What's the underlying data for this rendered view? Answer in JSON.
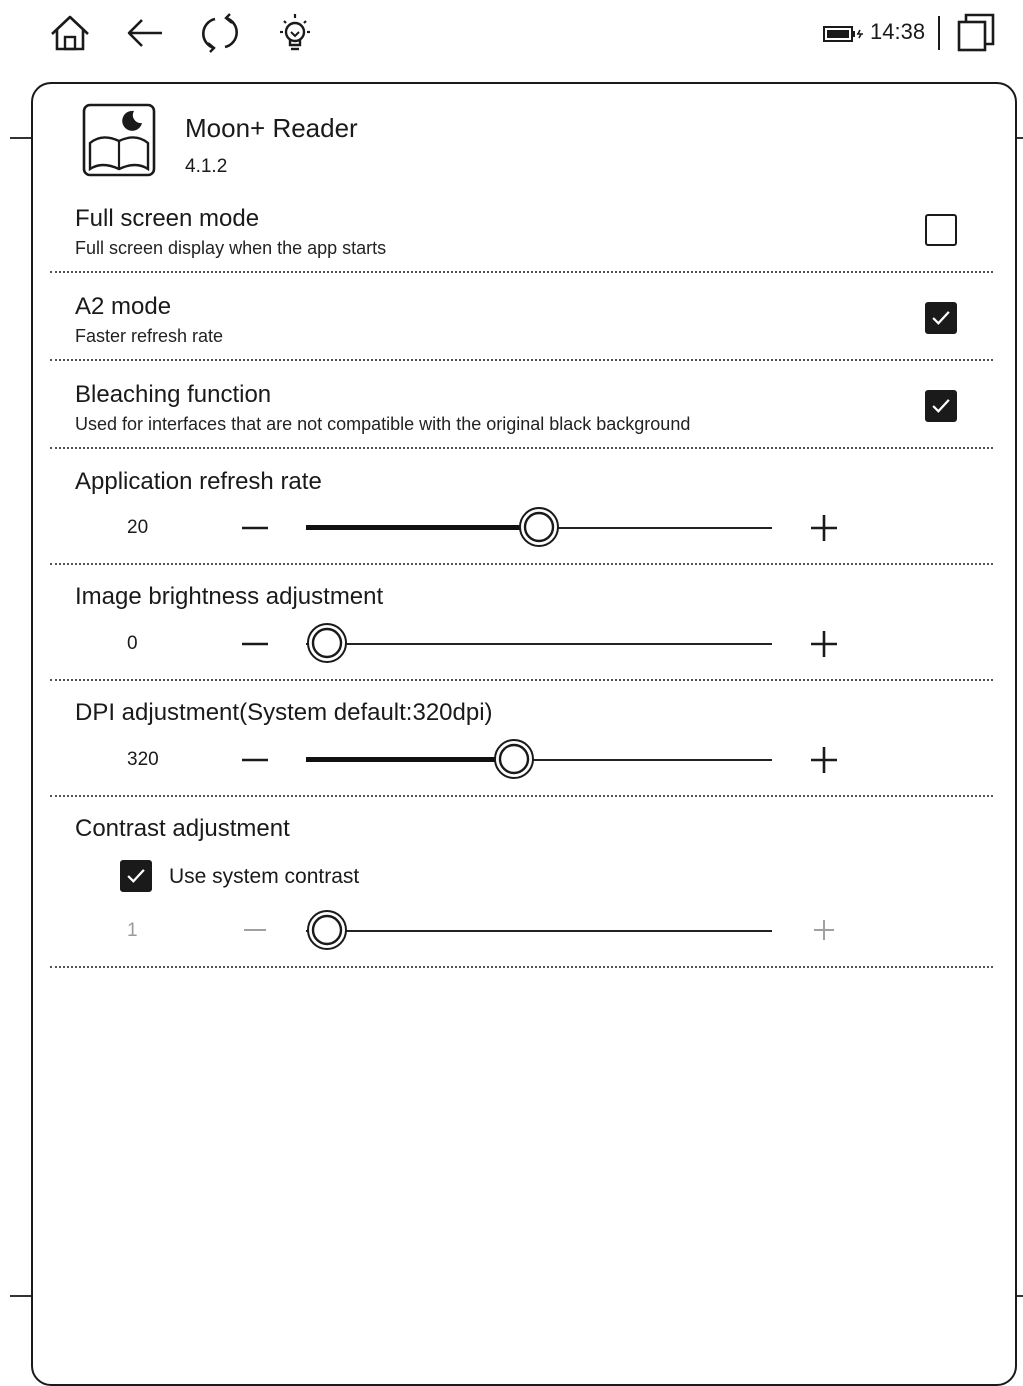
{
  "status_bar": {
    "time": "14:38",
    "icons": [
      "home-icon",
      "back-icon",
      "refresh-icon",
      "lightbulb-icon",
      "battery-icon",
      "recent-apps-icon"
    ]
  },
  "app": {
    "name": "Moon+ Reader",
    "version": "4.1.2",
    "icon": "book-moon-icon"
  },
  "settings": {
    "full_screen": {
      "title": "Full screen mode",
      "description": "Full screen display when the app starts",
      "checked": false
    },
    "a2_mode": {
      "title": "A2 mode",
      "description": "Faster refresh rate",
      "checked": true
    },
    "bleaching": {
      "title": "Bleaching function",
      "description": "Used for interfaces that are not compatible with the original black background",
      "checked": true
    },
    "refresh_rate": {
      "title": "Application refresh rate",
      "value": "20",
      "fraction": 0.5
    },
    "image_brightness": {
      "title": "Image brightness adjustment",
      "value": "0",
      "fraction": 0.0
    },
    "dpi": {
      "title": "DPI adjustment(System default:320dpi)",
      "value": "320",
      "fraction": 0.44
    },
    "contrast": {
      "title": "Contrast adjustment",
      "use_system_label": "Use system contrast",
      "use_system_checked": true,
      "value": "1",
      "fraction": 0.0,
      "disabled": true
    }
  },
  "controls": {
    "minus_icon": "minus-icon",
    "plus_icon": "plus-icon",
    "check_icon": "check-icon"
  }
}
